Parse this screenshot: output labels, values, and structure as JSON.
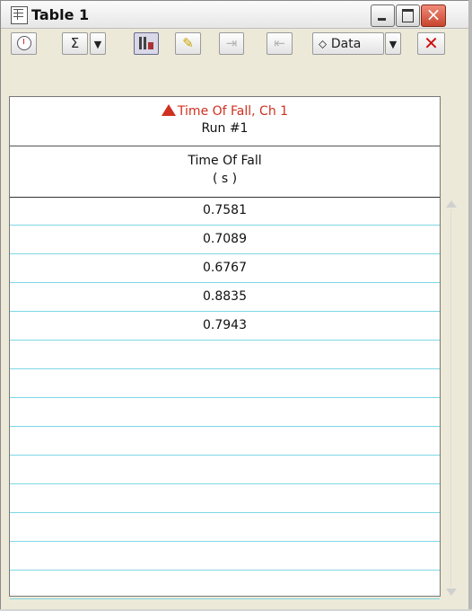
{
  "window": {
    "title": "Table 1"
  },
  "toolbar": {
    "sum_label": "Σ",
    "dropdown_arrow": "▼",
    "data_label": "Data",
    "close_label": "✕"
  },
  "table": {
    "series_label": "Time Of Fall, Ch 1",
    "run_label": "Run #1",
    "column_header": "Time Of Fall",
    "column_unit": "( s )",
    "values": [
      "0.7581",
      "0.7089",
      "0.6767",
      "0.8835",
      "0.7943"
    ]
  },
  "colors": {
    "accent_red": "#d03020",
    "row_line": "#7fd8e4"
  }
}
